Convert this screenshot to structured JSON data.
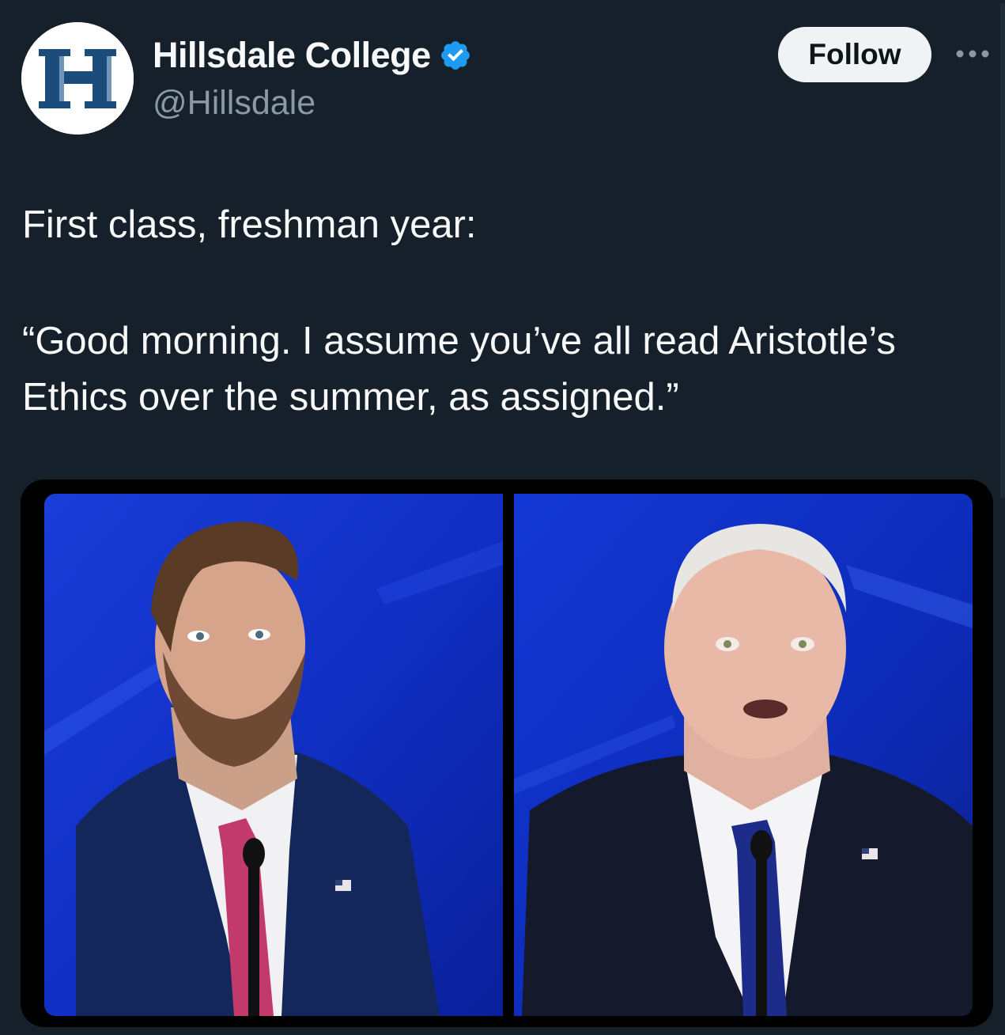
{
  "account": {
    "display_name": "Hillsdale College",
    "handle": "@Hillsdale",
    "avatar_letter": "H",
    "verified": true,
    "verified_icon": "verified-badge-icon",
    "verified_color": "#1d9bf0"
  },
  "actions": {
    "follow_label": "Follow",
    "more_icon": "more-icon"
  },
  "tweet": {
    "line_1": "First class, freshman year:",
    "line_2": "“Good morning. I assume you’ve all read Aristotle’s",
    "line_3": "Ethics over the summer, as assigned.”"
  },
  "media": {
    "panels": [
      "debate-photo-left",
      "debate-photo-right"
    ]
  },
  "colors": {
    "background": "#15202b",
    "text": "#f7f9f9",
    "secondary_text": "#8b98a5",
    "follow_bg": "#eff3f4",
    "avatar_letter": "#1c4c7c"
  }
}
